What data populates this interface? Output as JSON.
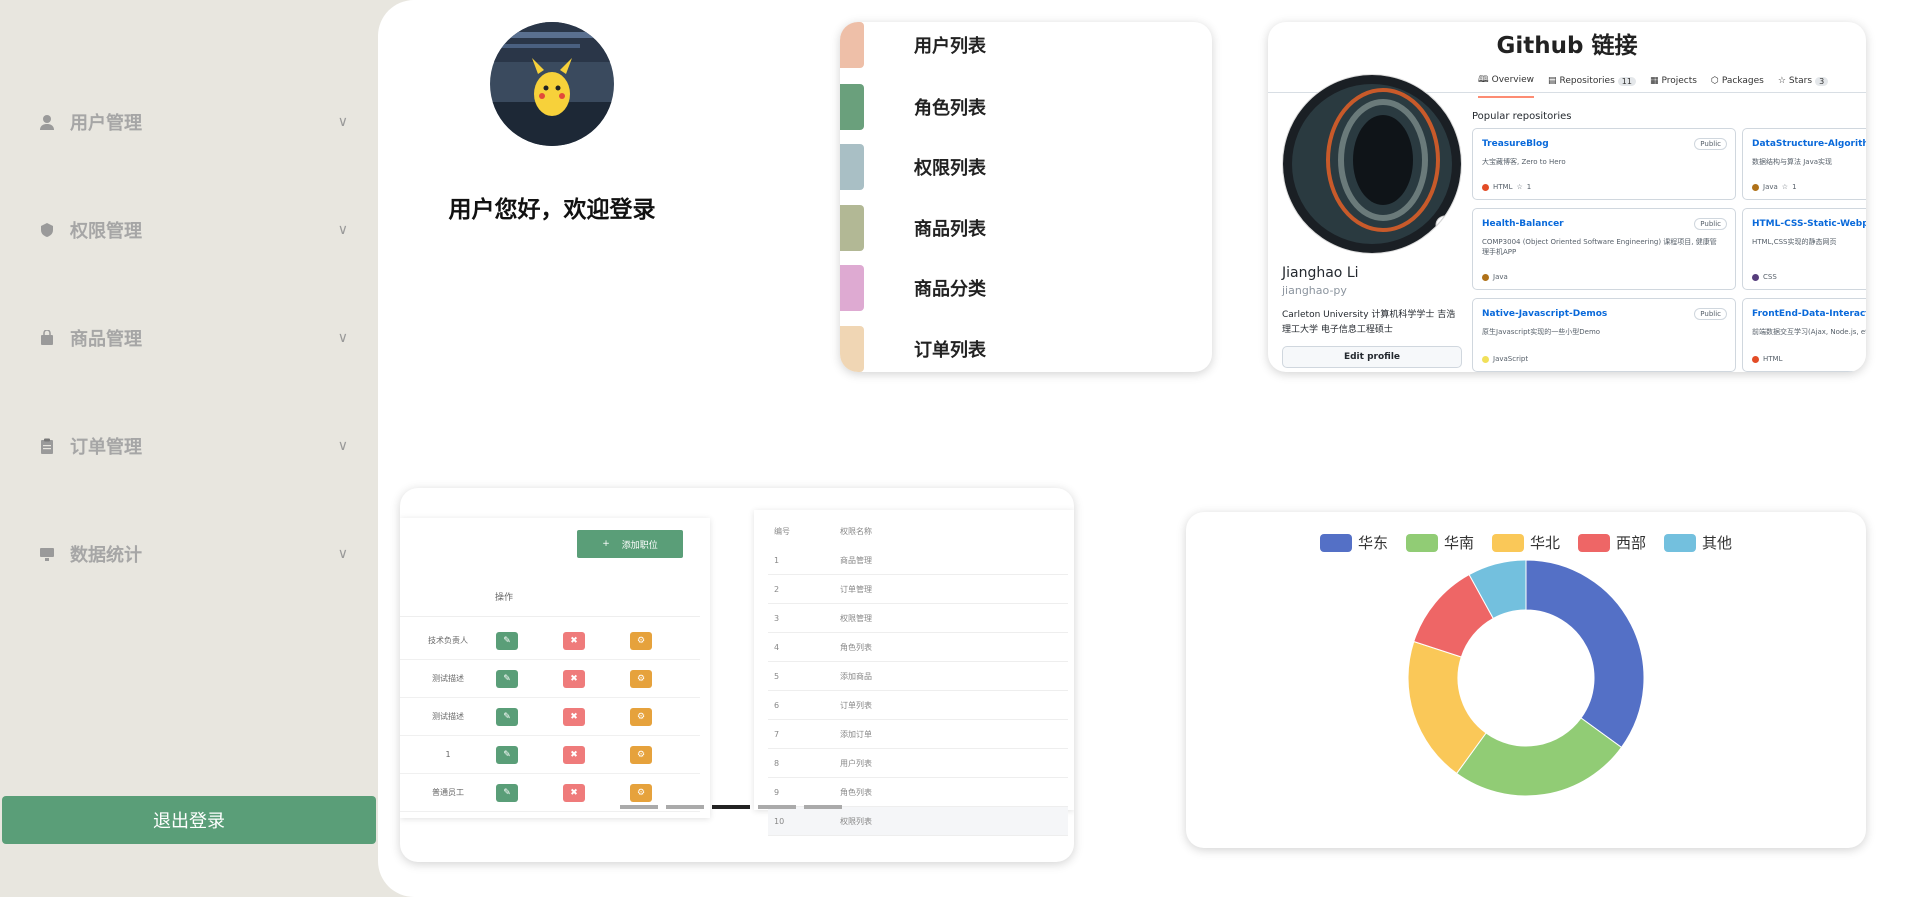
{
  "sidebar": {
    "items": [
      {
        "label": "用户管理",
        "icon": "user-icon"
      },
      {
        "label": "权限管理",
        "icon": "shield-icon"
      },
      {
        "label": "商品管理",
        "icon": "bag-icon"
      },
      {
        "label": "订单管理",
        "icon": "clipboard-icon"
      },
      {
        "label": "数据统计",
        "icon": "monitor-icon"
      }
    ],
    "logout_label": "退出登录"
  },
  "welcome": {
    "text": "用户您好，欢迎登录"
  },
  "menu_list": [
    {
      "label": "用户列表",
      "color": "#eebfa8"
    },
    {
      "label": "角色列表",
      "color": "#6aa07c"
    },
    {
      "label": "权限列表",
      "color": "#a9bfc5"
    },
    {
      "label": "商品列表",
      "color": "#b2b895"
    },
    {
      "label": "商品分类",
      "color": "#deaad2"
    },
    {
      "label": "订单列表",
      "color": "#f0d6b4"
    }
  ],
  "github": {
    "title": "Github 链接",
    "tabs": [
      {
        "label": "Overview",
        "count": ""
      },
      {
        "label": "Repositories",
        "count": "11"
      },
      {
        "label": "Projects",
        "count": ""
      },
      {
        "label": "Packages",
        "count": ""
      },
      {
        "label": "Stars",
        "count": "3"
      }
    ],
    "name": "Jianghao Li",
    "username": "jianghao-py",
    "bio": "Carleton University 计算机科学学士 吉浩理工大学 电子信息工程硕士",
    "edit_label": "Edit profile",
    "popular_label": "Popular repositories",
    "repos": [
      {
        "name": "TreasureBlog",
        "badge": "Public",
        "desc": "大宝藏博客, Zero to Hero",
        "lang": "HTML",
        "lang_color": "#e34c26",
        "stars": "1"
      },
      {
        "name": "DataStructure-Algorithm",
        "badge": "",
        "desc": "数据结构与算法 Java实现",
        "lang": "Java",
        "lang_color": "#b07219",
        "stars": "1"
      },
      {
        "name": "Health-Balancer",
        "badge": "Public",
        "desc": "COMP3004 (Object Oriented Software Engineering) 课程项目, 健康管理手机APP",
        "lang": "Java",
        "lang_color": "#b07219",
        "stars": ""
      },
      {
        "name": "HTML-CSS-Static-Webpages",
        "badge": "",
        "desc": "HTML,CSS实现的静态网页",
        "lang": "CSS",
        "lang_color": "#563d7c",
        "stars": ""
      },
      {
        "name": "Native-Javascript-Demos",
        "badge": "Public",
        "desc": "原生Javascript实现的一些小型Demo",
        "lang": "JavaScript",
        "lang_color": "#f1e05a",
        "stars": ""
      },
      {
        "name": "FrontEnd-Data-Interaction",
        "badge": "",
        "desc": "前端数据交互学习(Ajax, Node.js, etc.)",
        "lang": "HTML",
        "lang_color": "#e34c26",
        "stars": ""
      }
    ]
  },
  "table_preview": {
    "add_button": "添加职位",
    "ops_header": "操作",
    "left_rows": [
      "技术负责人",
      "测试描述",
      "测试描述",
      "1",
      "普通员工"
    ],
    "right_headers": [
      "编号",
      "权限名称"
    ],
    "right_rows": [
      {
        "id": "1",
        "name": "商品管理"
      },
      {
        "id": "2",
        "name": "订单管理"
      },
      {
        "id": "3",
        "name": "权限管理"
      },
      {
        "id": "4",
        "name": "角色列表"
      },
      {
        "id": "5",
        "name": "添加商品"
      },
      {
        "id": "6",
        "name": "订单列表"
      },
      {
        "id": "7",
        "name": "添加订单"
      },
      {
        "id": "8",
        "name": "用户列表"
      },
      {
        "id": "9",
        "name": "角色列表"
      },
      {
        "id": "10",
        "name": "权限列表"
      }
    ]
  },
  "chart_data": {
    "type": "pie",
    "title": "",
    "donut": true,
    "legend_position": "top",
    "series": [
      {
        "name": "华东",
        "value": 35,
        "color": "#5470c6"
      },
      {
        "name": "华南",
        "value": 25,
        "color": "#91cc75"
      },
      {
        "name": "华北",
        "value": 20,
        "color": "#fac858"
      },
      {
        "name": "西部",
        "value": 12,
        "color": "#ee6666"
      },
      {
        "name": "其他",
        "value": 8,
        "color": "#73c0de"
      }
    ]
  }
}
